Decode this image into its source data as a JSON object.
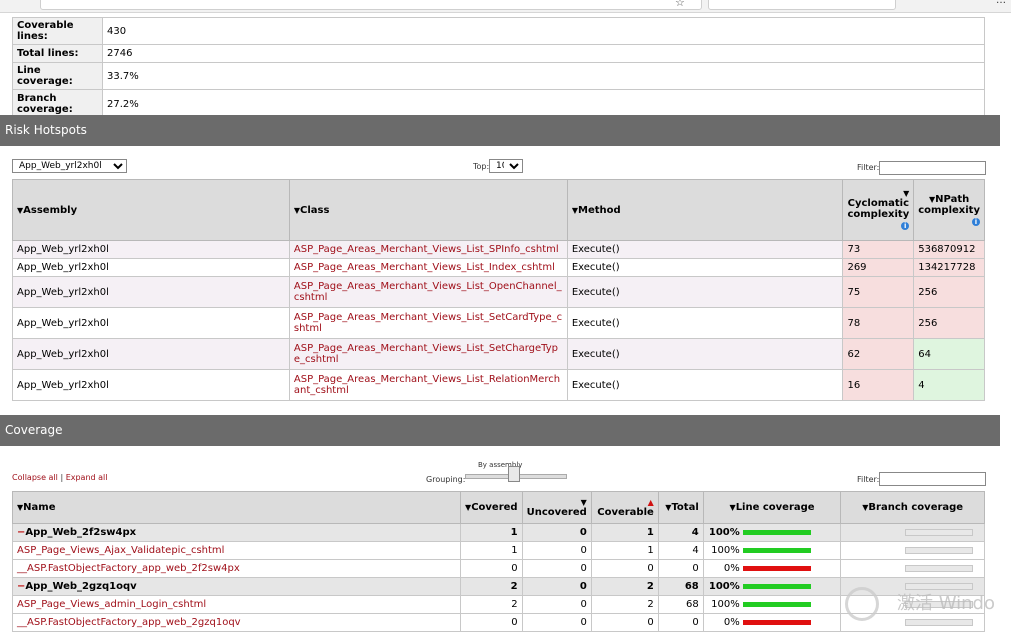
{
  "summary": {
    "rows": [
      {
        "label": "Coverable lines:",
        "value": "430"
      },
      {
        "label": "Total lines:",
        "value": "2746"
      },
      {
        "label": "Line coverage:",
        "value": "33.7%"
      },
      {
        "label": "Branch coverage:",
        "value": "27.2%"
      }
    ]
  },
  "risk": {
    "title": "Risk Hotspots",
    "assembly_select": "App_Web_yrl2xh0l",
    "top_label": "Top:",
    "top_value": "10",
    "filter_label": "Filter:",
    "headers": {
      "assembly": "Assembly",
      "class": "Class",
      "method": "Method",
      "cyclomatic": "Cyclomatic complexity",
      "npath": "NPath complexity"
    },
    "rows": [
      {
        "assembly": "App_Web_yrl2xh0l",
        "class": "ASP_Page_Areas_Merchant_Views_List_SPInfo_cshtml",
        "method": "Execute()",
        "cyclomatic": "73",
        "npath": "536870912"
      },
      {
        "assembly": "App_Web_yrl2xh0l",
        "class": "ASP_Page_Areas_Merchant_Views_List_Index_cshtml",
        "method": "Execute()",
        "cyclomatic": "269",
        "npath": "134217728"
      },
      {
        "assembly": "App_Web_yrl2xh0l",
        "class": "ASP_Page_Areas_Merchant_Views_List_OpenChannel_cshtml",
        "method": "Execute()",
        "cyclomatic": "75",
        "npath": "256"
      },
      {
        "assembly": "App_Web_yrl2xh0l",
        "class": "ASP_Page_Areas_Merchant_Views_List_SetCardType_cshtml",
        "method": "Execute()",
        "cyclomatic": "78",
        "npath": "256"
      },
      {
        "assembly": "App_Web_yrl2xh0l",
        "class": "ASP_Page_Areas_Merchant_Views_List_SetChargeType_cshtml",
        "method": "Execute()",
        "cyclomatic": "62",
        "npath": "64"
      },
      {
        "assembly": "App_Web_yrl2xh0l",
        "class": "ASP_Page_Areas_Merchant_Views_List_RelationMerchant_cshtml",
        "method": "Execute()",
        "cyclomatic": "16",
        "npath": "4"
      }
    ]
  },
  "coverage": {
    "title": "Coverage",
    "collapse_all": "Collapse all",
    "expand_all": "Expand all",
    "separator": "|",
    "grouping_label": "Grouping:",
    "grouping_value": "By assembly",
    "filter_label": "Filter:",
    "headers": {
      "name": "Name",
      "covered": "Covered",
      "uncovered": "Uncovered",
      "coverable": "Coverable",
      "total": "Total",
      "line_coverage": "Line coverage",
      "branch_coverage": "Branch coverage"
    },
    "rows": [
      {
        "group": true,
        "name": "App_Web_2f2sw4px",
        "covered": "1",
        "uncovered": "0",
        "coverable": "1",
        "total": "4",
        "pct": "100%",
        "line_fraction": 1.0
      },
      {
        "group": false,
        "name": "ASP_Page_Views_Ajax_Validatepic_cshtml",
        "covered": "1",
        "uncovered": "0",
        "coverable": "1",
        "total": "4",
        "pct": "100%",
        "line_fraction": 1.0
      },
      {
        "group": false,
        "name": "__ASP.FastObjectFactory_app_web_2f2sw4px",
        "covered": "0",
        "uncovered": "0",
        "coverable": "0",
        "total": "0",
        "pct": "0%",
        "line_fraction": 0.0
      },
      {
        "group": true,
        "name": "App_Web_2gzq1oqv",
        "covered": "2",
        "uncovered": "0",
        "coverable": "2",
        "total": "68",
        "pct": "100%",
        "line_fraction": 1.0
      },
      {
        "group": false,
        "name": "ASP_Page_Views_admin_Login_cshtml",
        "covered": "2",
        "uncovered": "0",
        "coverable": "2",
        "total": "68",
        "pct": "100%",
        "line_fraction": 1.0
      },
      {
        "group": false,
        "name": "__ASP.FastObjectFactory_app_web_2gzq1oqv",
        "covered": "0",
        "uncovered": "0",
        "coverable": "0",
        "total": "0",
        "pct": "0%",
        "line_fraction": 0.0
      }
    ]
  },
  "colors": {
    "section_header": "#6b6b6b",
    "link": "#a0101a",
    "bar_green": "#22cc22",
    "bar_red": "#e01010",
    "risk_red": "#f7dede",
    "risk_green": "#dff5df"
  },
  "watermark": {
    "text": "激活 Windo"
  }
}
